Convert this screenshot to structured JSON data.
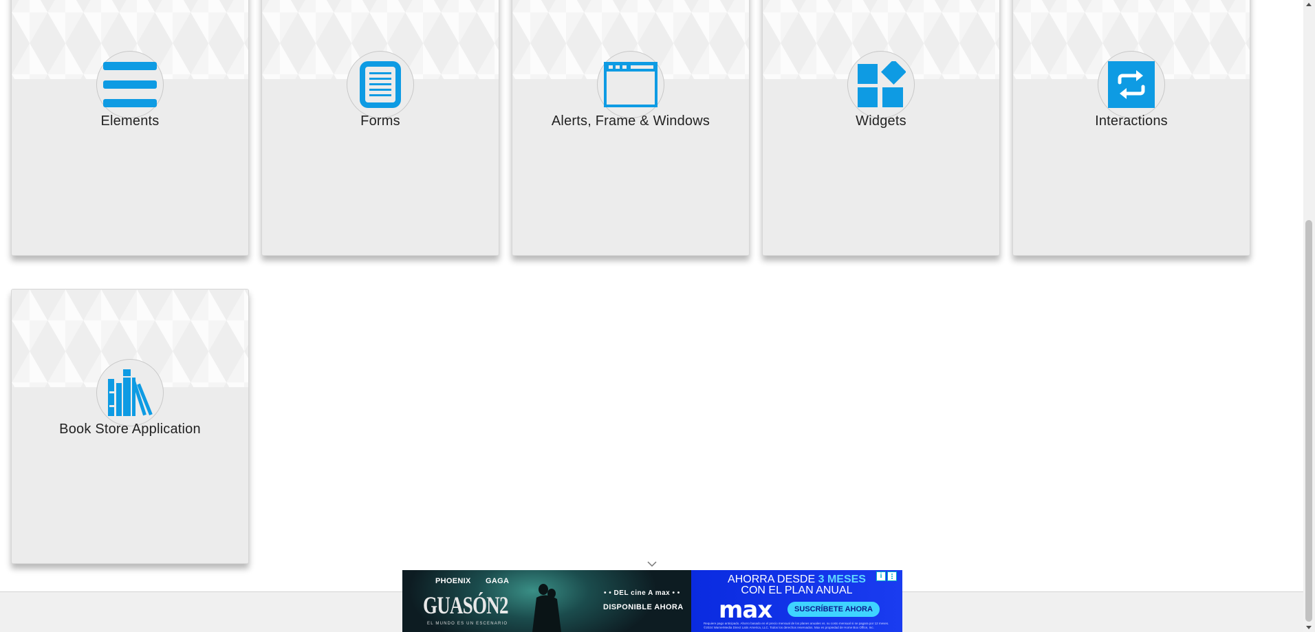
{
  "cards": [
    {
      "title": "Elements",
      "icon": "hamburger-list-icon"
    },
    {
      "title": "Forms",
      "icon": "document-icon"
    },
    {
      "title": "Alerts, Frame & Windows",
      "icon": "browser-window-icon"
    },
    {
      "title": "Widgets",
      "icon": "widgets-icon"
    },
    {
      "title": "Interactions",
      "icon": "repeat-arrows-icon"
    },
    {
      "title": "Book Store Application",
      "icon": "books-icon"
    }
  ],
  "colors": {
    "accent": "#0e9be3",
    "card_bg": "#ececec",
    "ad_blue": "#1226d6",
    "ad_cta": "#3fd4ff"
  },
  "ad": {
    "actor1": "PHOENIX",
    "actor2": "GAGA",
    "movie": "GUASÓN2",
    "tagline": "EL MUNDO ES UN ESCENARIO",
    "brand_line": "• • DEL cine A max • •",
    "availability": "DISPONIBLE AHORA",
    "headline_prefix": "AHORRA DESDE ",
    "headline_highlight": "3 MESES",
    "headline_line2": "CON EL PLAN ANUAL",
    "logo": "max",
    "cta": "SUSCRÍBETE AHORA",
    "fine_print": "Requiere pago anticipado. Ahorro basado en el precio mensual de los planes anuales vs. su costo mensual si se pagara por 12 meses. ©2024 WarnerMedia Direct Latin America, LLC. Todos los derechos reservados. Max es propiedad de Home Box Office, Inc.",
    "info_glyph": "i"
  }
}
